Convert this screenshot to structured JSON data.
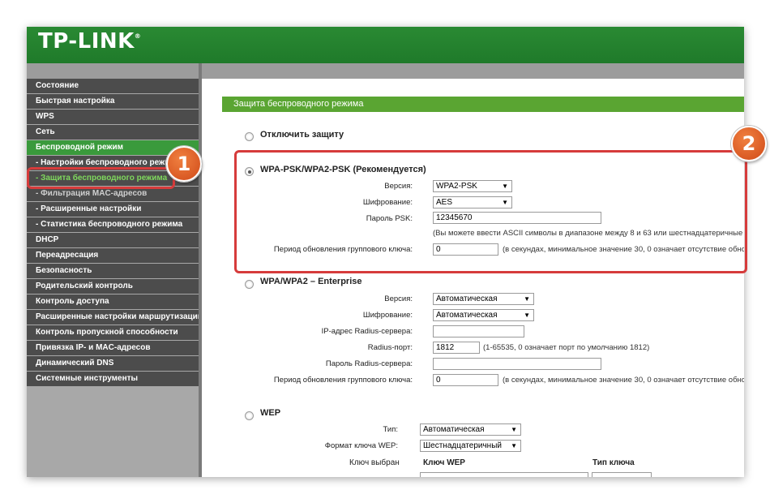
{
  "brand": {
    "logo": "TP-LINK",
    "reg_mark": "®"
  },
  "sidebar": {
    "items": [
      {
        "label": "Состояние",
        "type": "main"
      },
      {
        "label": "Быстрая настройка",
        "type": "main"
      },
      {
        "label": "WPS",
        "type": "main"
      },
      {
        "label": "Сеть",
        "type": "main"
      },
      {
        "label": "Беспроводной режим",
        "type": "active"
      },
      {
        "label": "- Настройки беспроводного режима",
        "type": "sub"
      },
      {
        "label": "- Защита беспроводного режима",
        "type": "current"
      },
      {
        "label": "- Фильтрация MAC-адресов",
        "type": "dim"
      },
      {
        "label": "- Расширенные настройки",
        "type": "sub"
      },
      {
        "label": "- Статистика беспроводного режима",
        "type": "sub"
      },
      {
        "label": "DHCP",
        "type": "main"
      },
      {
        "label": "Переадресация",
        "type": "main"
      },
      {
        "label": "Безопасность",
        "type": "main"
      },
      {
        "label": "Родительский контроль",
        "type": "main"
      },
      {
        "label": "Контроль доступа",
        "type": "main"
      },
      {
        "label": "Расширенные настройки маршрутизации",
        "type": "main"
      },
      {
        "label": "Контроль пропускной способности",
        "type": "main"
      },
      {
        "label": "Привязка IP- и MAC-адресов",
        "type": "main"
      },
      {
        "label": "Динамический DNS",
        "type": "main"
      },
      {
        "label": "Системные инструменты",
        "type": "main"
      }
    ]
  },
  "page": {
    "title": "Защита беспроводного режима"
  },
  "disable": {
    "label": "Отключить защиту"
  },
  "wpa_psk": {
    "label": "WPA-PSK/WPA2-PSK (Рекомендуется)",
    "version_label": "Версия:",
    "version_value": "WPA2-PSK",
    "encryption_label": "Шифрование:",
    "encryption_value": "AES",
    "psk_label": "Пароль PSK:",
    "psk_value": "12345670",
    "psk_note": "(Вы можете ввести ASCII символы в диапазоне между 8 и 63 или шестнадцатеричные",
    "group_label": "Период обновления группового ключа:",
    "group_value": "0",
    "group_note": "(в секундах, минимальное значение 30, 0 означает отсутствие обно"
  },
  "enterprise": {
    "label": "WPA/WPA2 – Enterprise",
    "version_label": "Версия:",
    "version_value": "Автоматическая",
    "encryption_label": "Шифрование:",
    "encryption_value": "Автоматическая",
    "radius_ip_label": "IP-адрес Radius-сервера:",
    "radius_ip_value": "",
    "radius_port_label": "Radius-порт:",
    "radius_port_value": "1812",
    "radius_port_note": "(1-65535, 0 означает порт по умолчанию 1812)",
    "radius_pass_label": "Пароль Radius-сервера:",
    "radius_pass_value": "",
    "group_label": "Период обновления группового ключа:",
    "group_value": "0",
    "group_note": "(в секундах, минимальное значение 30, 0 означает отсутствие обнов"
  },
  "wep": {
    "label": "WEP",
    "type_label": "Тип:",
    "type_value": "Автоматическая",
    "format_label": "Формат ключа WEP:",
    "format_value": "Шестнадцатеричный",
    "selected_header": "Ключ выбран",
    "key_header": "Ключ WEP",
    "keytype_header": "Тип ключа"
  },
  "annotations": {
    "badge1": "1",
    "badge2": "2",
    "color": "#d63b3b"
  }
}
